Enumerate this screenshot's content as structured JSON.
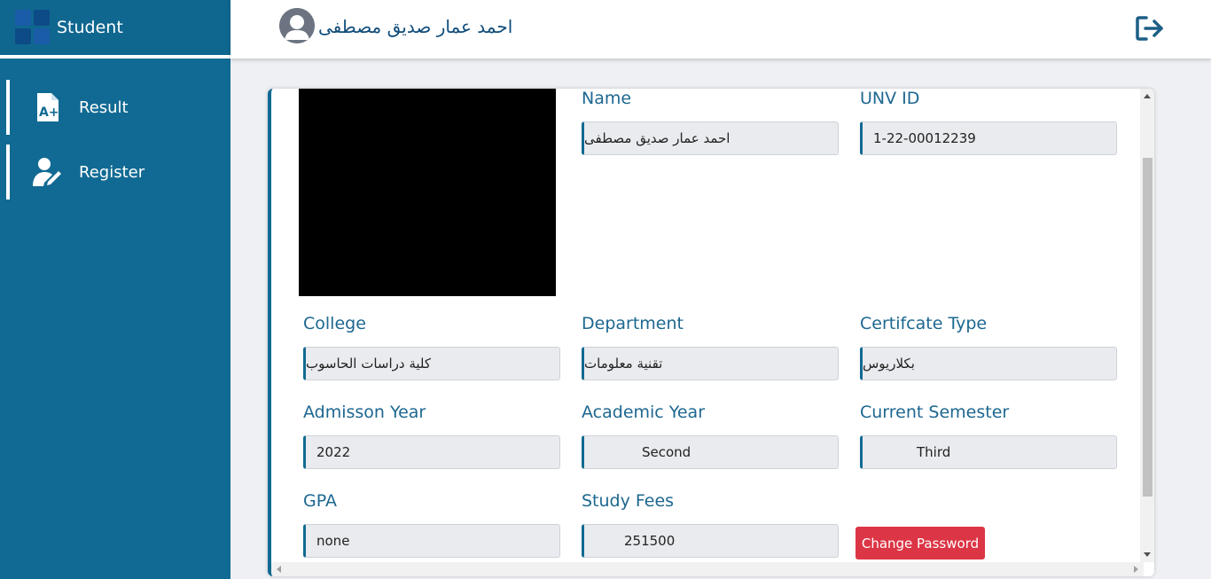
{
  "brand": {
    "title": "Student"
  },
  "sidebar": {
    "items": [
      {
        "label": "Result",
        "icon": "result-file-icon"
      },
      {
        "label": "Register",
        "icon": "user-edit-icon"
      }
    ]
  },
  "header": {
    "user_name": "احمد عمار صديق مصطفى",
    "logout_icon": "logout-icon"
  },
  "profile": {
    "name_label": "Name",
    "name_value": "احمد عمار صديق مصطفى",
    "unv_id_label": "UNV ID",
    "unv_id_value": "1-22-00012239",
    "college_label": "College",
    "college_value": "كلية دراسات الحاسوب",
    "department_label": "Department",
    "department_value": "تقنية معلومات",
    "cert_type_label": "Certifcate Type",
    "cert_type_value": "بكلاريوس",
    "admission_year_label": "Admisson Year",
    "admission_year_value": "2022",
    "academic_year_label": "Academic Year",
    "academic_year_value": "Second",
    "current_semester_label": "Current Semester",
    "current_semester_value": "Third",
    "gpa_label": "GPA",
    "gpa_value": "none",
    "study_fees_label": "Study Fees",
    "study_fees_value": "251500",
    "change_password_label": "Change Password"
  },
  "colors": {
    "sidebar": "#116a93",
    "accent": "#116a93",
    "danger": "#dc3545",
    "label_text": "#1d6790"
  }
}
